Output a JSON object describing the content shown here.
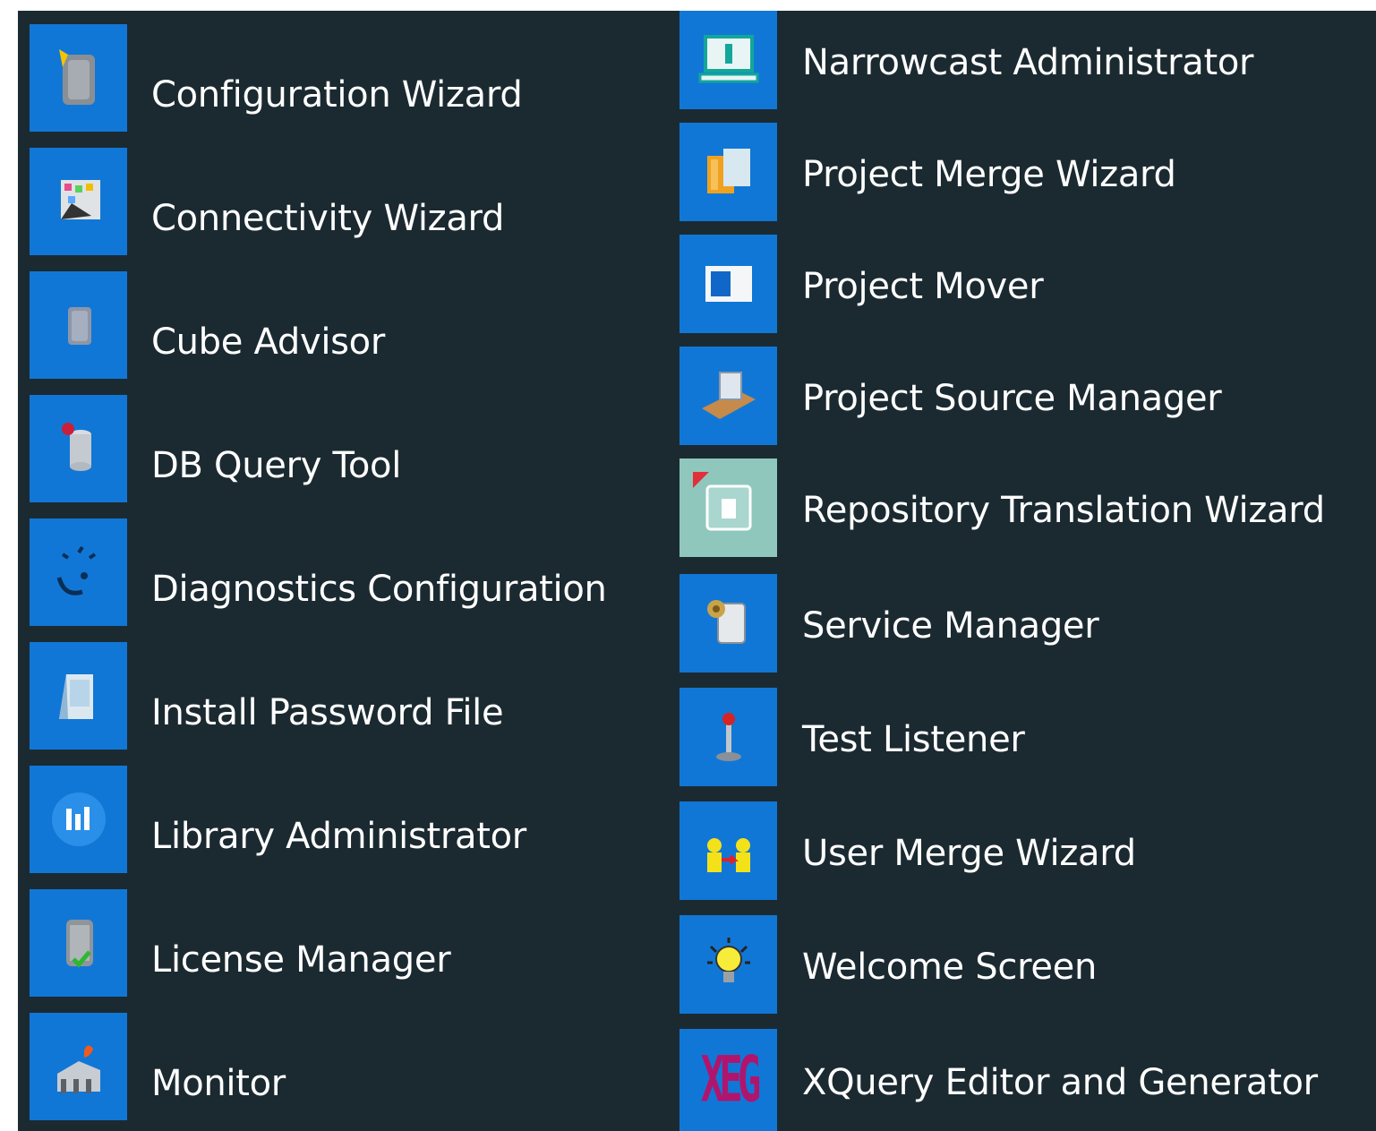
{
  "left_column": [
    {
      "label": "Configuration Wizard",
      "icon": "configuration-wizard-icon"
    },
    {
      "label": "Connectivity Wizard",
      "icon": "connectivity-wizard-icon"
    },
    {
      "label": "Cube Advisor",
      "icon": "cube-advisor-icon"
    },
    {
      "label": "DB Query Tool",
      "icon": "db-query-tool-icon"
    },
    {
      "label": "Diagnostics Configuration",
      "icon": "diagnostics-configuration-icon"
    },
    {
      "label": "Install Password File",
      "icon": "install-password-file-icon"
    },
    {
      "label": "Library Administrator",
      "icon": "library-administrator-icon"
    },
    {
      "label": "License Manager",
      "icon": "license-manager-icon"
    },
    {
      "label": "Monitor",
      "icon": "monitor-icon"
    }
  ],
  "right_column": [
    {
      "label": "Narrowcast Administrator",
      "icon": "narrowcast-administrator-icon"
    },
    {
      "label": "Project Merge Wizard",
      "icon": "project-merge-wizard-icon"
    },
    {
      "label": "Project Mover",
      "icon": "project-mover-icon"
    },
    {
      "label": "Project Source Manager",
      "icon": "project-source-manager-icon"
    },
    {
      "label": "Repository Translation Wizard",
      "icon": "repository-translation-wizard-icon"
    },
    {
      "label": "Service Manager",
      "icon": "service-manager-icon"
    },
    {
      "label": "Test Listener",
      "icon": "test-listener-icon"
    },
    {
      "label": "User Merge Wizard",
      "icon": "user-merge-wizard-icon"
    },
    {
      "label": "Welcome Screen",
      "icon": "welcome-screen-icon"
    },
    {
      "label": "XQuery Editor and Generator",
      "icon": "xquery-editor-icon",
      "icon_text": "XEG"
    }
  ],
  "colors": {
    "background": "#1b2a31",
    "tile": "#1177d6",
    "text": "#ffffff"
  }
}
